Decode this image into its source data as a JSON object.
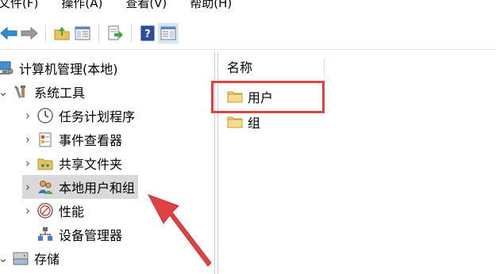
{
  "menubar": {
    "items": [
      "文件(F)",
      "操作(A)",
      "查看(V)",
      "帮助(H)"
    ]
  },
  "toolbar": {
    "icons": [
      "back-icon",
      "forward-icon",
      "up-folder-icon",
      "show-hide-console-tree-icon",
      "export-list-icon",
      "help-icon",
      "properties-icon"
    ]
  },
  "tree": {
    "root": "计算机管理(本地)",
    "system_tools": "系统工具",
    "task_scheduler": "任务计划程序",
    "event_viewer": "事件查看器",
    "shared_folders": "共享文件夹",
    "local_users_groups": "本地用户和组",
    "performance": "性能",
    "device_manager": "设备管理器",
    "storage": "存储"
  },
  "list": {
    "column_name": "名称",
    "items": [
      "用户",
      "组"
    ]
  },
  "colors": {
    "highlight": "#e04141",
    "selected_row": "#d9d9d9",
    "folder": "#e8c35a"
  }
}
